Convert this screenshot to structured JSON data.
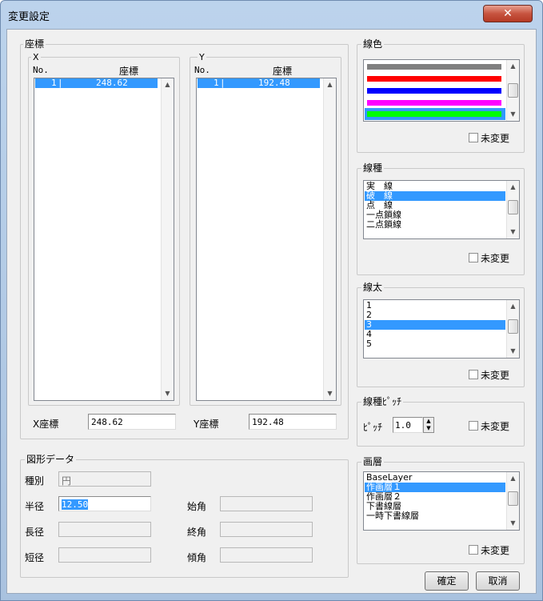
{
  "window": {
    "title": "変更設定",
    "close": "✕"
  },
  "coords": {
    "group": "座標",
    "x": {
      "label": "X",
      "col_no": "No.",
      "col_coord": "座標",
      "row_no": "1",
      "row_value": "248.62",
      "field_label": "X座標",
      "field_value": "248.62"
    },
    "y": {
      "label": "Y",
      "col_no": "No.",
      "col_coord": "座標",
      "row_no": "1",
      "row_value": "192.48",
      "field_label": "Y座標",
      "field_value": "192.48"
    }
  },
  "shape": {
    "group": "図形データ",
    "type_label": "種別",
    "type_value": "円",
    "radius_label": "半径",
    "radius_value": "12.50",
    "major_label": "長径",
    "minor_label": "短径",
    "start_label": "始角",
    "end_label": "終角",
    "tilt_label": "傾角"
  },
  "line_color": {
    "group": "線色",
    "colors": [
      "#808080",
      "#ff0000",
      "#0000ff",
      "#ff00ff",
      "#00ff00"
    ],
    "selected_index": 4,
    "unchanged": "未変更"
  },
  "line_type": {
    "group": "線種",
    "items": [
      "実　線",
      "破　線",
      "点　線",
      "一点鎖線",
      "二点鎖線"
    ],
    "selected_index": 1,
    "unchanged": "未変更"
  },
  "line_width": {
    "group": "線太",
    "items": [
      "1",
      "2",
      "3",
      "4",
      "5"
    ],
    "selected_index": 2,
    "unchanged": "未変更"
  },
  "pitch": {
    "group": "線種ﾋﾟｯﾁ",
    "label": "ﾋﾟｯﾁ",
    "value": "1.0",
    "unchanged": "未変更"
  },
  "layer": {
    "group": "画層",
    "items": [
      "BaseLayer",
      "作画層１",
      "作画層２",
      "下書線層",
      "一時下書線層"
    ],
    "selected_index": 1,
    "unchanged": "未変更"
  },
  "buttons": {
    "ok": "確定",
    "cancel": "取消"
  }
}
